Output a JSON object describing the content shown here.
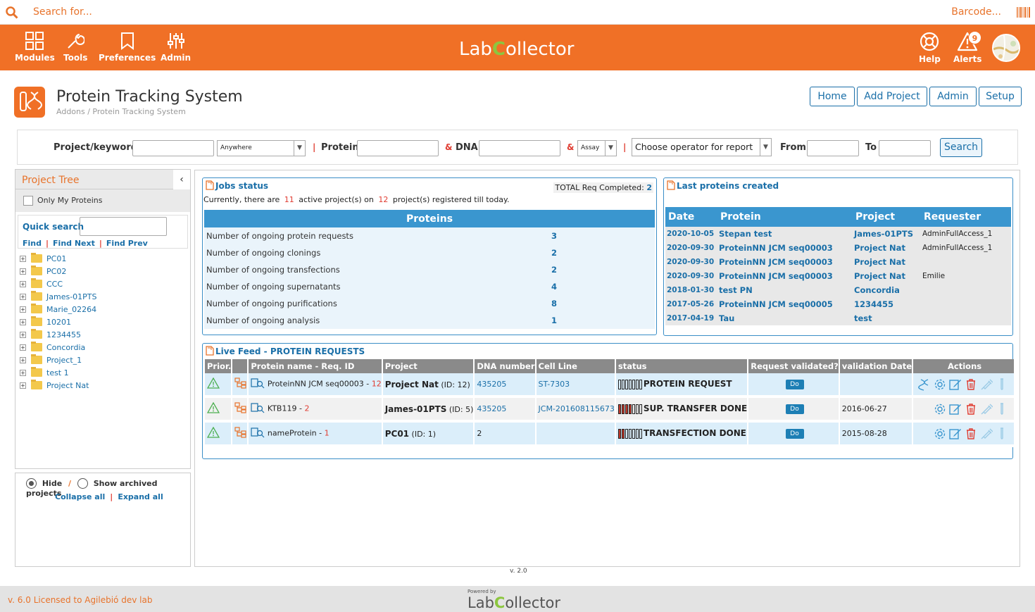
{
  "topbar": {
    "search_placeholder": "Search for...",
    "barcode_label": "Barcode..."
  },
  "nav": {
    "modules": "Modules",
    "tools": "Tools",
    "preferences": "Preferences",
    "admin": "Admin",
    "help": "Help",
    "alerts": "Alerts",
    "alerts_count": "9"
  },
  "logo": {
    "pre": "Lab",
    "c": "C",
    "post": "ollector"
  },
  "page": {
    "title": "Protein Tracking System",
    "breadcrumb": "Addons / Protein Tracking System"
  },
  "top_buttons": {
    "home": "Home",
    "add_project": "Add Project",
    "admin": "Admin",
    "setup": "Setup"
  },
  "searchbar": {
    "project_label": "Project/keyword",
    "location_value": "Anywhere",
    "protein_label": "Protein",
    "dna_label": "DNA",
    "assay_value": "Assay",
    "operator_value": "Choose operator for report",
    "from_label": "From",
    "to_label": "To",
    "search_button": "Search",
    "sep_pipe": "|",
    "sep_amp": "&"
  },
  "left": {
    "tree_title": "Project Tree",
    "collapse_glyph": "‹",
    "only_my": "Only My Proteins",
    "quick_search": "Quick search",
    "find": "Find",
    "find_next": "Find Next",
    "find_prev": "Find Prev",
    "tree": [
      "PC01",
      "PC02",
      "CCC",
      "James-01PTS",
      "Marie_02264",
      "10201",
      "1234455",
      "Concordia",
      "Project_1",
      "test 1",
      "Project Nat"
    ],
    "hide": "Hide",
    "show_archived": "Show archived projects",
    "collapse_all": "Collapse all",
    "expand_all": "Expand all"
  },
  "jobs": {
    "title": "Jobs status",
    "total_label": "TOTAL Req Completed:",
    "total_value": "2",
    "summary_pre": "Currently, there are",
    "active_count": "11",
    "summary_mid": "active project(s) on",
    "registered_count": "12",
    "summary_post": "project(s) registered till today.",
    "table_header": "Proteins",
    "rows": [
      {
        "label": "Number of ongoing protein requests",
        "value": "3"
      },
      {
        "label": "Number of ongoing clonings",
        "value": "2"
      },
      {
        "label": "Number of ongoing transfections",
        "value": "2"
      },
      {
        "label": "Number of ongoing supernatants",
        "value": "4"
      },
      {
        "label": "Number of ongoing purifications",
        "value": "8"
      },
      {
        "label": "Number of ongoing analysis",
        "value": "1"
      }
    ]
  },
  "last_proteins": {
    "title": "Last proteins created",
    "headers": [
      "Date",
      "Protein",
      "Project",
      "Requester"
    ],
    "rows": [
      {
        "date": "2020-10-05",
        "protein": "Stepan test",
        "project": "James-01PTS",
        "requester": "AdminFullAccess_1"
      },
      {
        "date": "2020-09-30",
        "protein": "ProteinNN JCM seq00003",
        "project": "Project Nat",
        "requester": "AdminFullAccess_1"
      },
      {
        "date": "2020-09-30",
        "protein": "ProteinNN JCM seq00003",
        "project": "Project Nat",
        "requester": ""
      },
      {
        "date": "2020-09-30",
        "protein": "ProteinNN JCM seq00003",
        "project": "Project Nat",
        "requester": "Emilie"
      },
      {
        "date": "2018-01-30",
        "protein": "test PN",
        "project": "Concordia",
        "requester": ""
      },
      {
        "date": "2017-05-26",
        "protein": "ProteinNN JCM seq00005",
        "project": "1234455",
        "requester": ""
      },
      {
        "date": "2017-04-19",
        "protein": "Tau",
        "project": "test",
        "requester": ""
      }
    ]
  },
  "feed": {
    "title": "Live Feed - PROTEIN REQUESTS",
    "headers": [
      "Prior.",
      "",
      "Protein name - Req. ID",
      "Project",
      "DNA number",
      "Cell Line",
      "status",
      "Request validated?",
      "validation Date",
      "Actions"
    ],
    "rows": [
      {
        "name": "ProteinNN JCM seq00003 - ",
        "req_id": "12",
        "project": "Project Nat",
        "project_id": "(ID: 12)",
        "dna": "435205",
        "cell_line": "ST-7303",
        "status": "PROTEIN REQUEST",
        "filled": 0,
        "do": "Do",
        "vdate": ""
      },
      {
        "name": "KTB119 - ",
        "req_id": "2",
        "project": "James-01PTS",
        "project_id": "(ID: 5)",
        "dna": "435205",
        "cell_line": "JCM-201608115673",
        "status": "SUP. TRANSFER DONE",
        "filled": 4,
        "do": "Do",
        "vdate": "2016-06-27"
      },
      {
        "name": "nameProtein - ",
        "req_id": "1",
        "project": "PC01",
        "project_id": "(ID: 1)",
        "dna": "2",
        "cell_line": "",
        "status": "TRANSFECTION DONE",
        "filled": 2,
        "do": "Do",
        "vdate": "2015-08-28"
      }
    ]
  },
  "version": "v. 2.0",
  "footer": {
    "license": "v. 6.0 Licensed to Agilebió dev lab",
    "powered": "Powered by"
  },
  "colors": {
    "brand": "#f07026",
    "accent": "#3a96cf",
    "link": "#1a6fa8",
    "alert_red": "#e03c31"
  }
}
